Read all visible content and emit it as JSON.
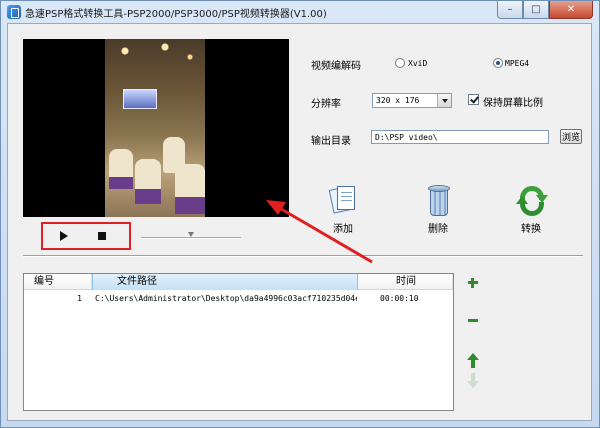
{
  "window": {
    "title": "急速PSP格式转换工具-PSP2000/PSP3000/PSP视频转换器(V1.00)",
    "minimize_glyph": "–",
    "maximize_glyph": "□",
    "close_glyph": "✕"
  },
  "settings": {
    "codec_label": "视频编解码",
    "codec_options": [
      "XviD",
      "MPEG4"
    ],
    "codec_selected": "MPEG4",
    "resolution_label": "分辨率",
    "resolution_value": "320 x 176",
    "keep_ratio_label": "保持屏幕比例",
    "keep_ratio_checked": true,
    "output_label": "输出目录",
    "output_path": "D:\\PSP video\\",
    "browse_label": "浏览"
  },
  "actions": {
    "add_label": "添加",
    "delete_label": "删除",
    "convert_label": "转换"
  },
  "file_list": {
    "columns": [
      "编号",
      "文件路径",
      "时间"
    ],
    "rows": [
      {
        "index": "1",
        "path": "C:\\Users\\Administrator\\Desktop\\da9a4996c03acf710235d04e...",
        "time": "00:00:10"
      }
    ]
  },
  "icons": {
    "play": "play-icon",
    "stop": "stop-icon",
    "add": "documents-icon",
    "delete": "trash-can-icon",
    "convert": "recycle-arrows-icon",
    "list_add": "plus-icon",
    "list_remove": "minus-icon",
    "move_up": "arrow-up-icon",
    "move_down": "arrow-down-icon"
  },
  "colors": {
    "annotation_red": "#e02020",
    "accent_green": "#2e8b2e"
  }
}
